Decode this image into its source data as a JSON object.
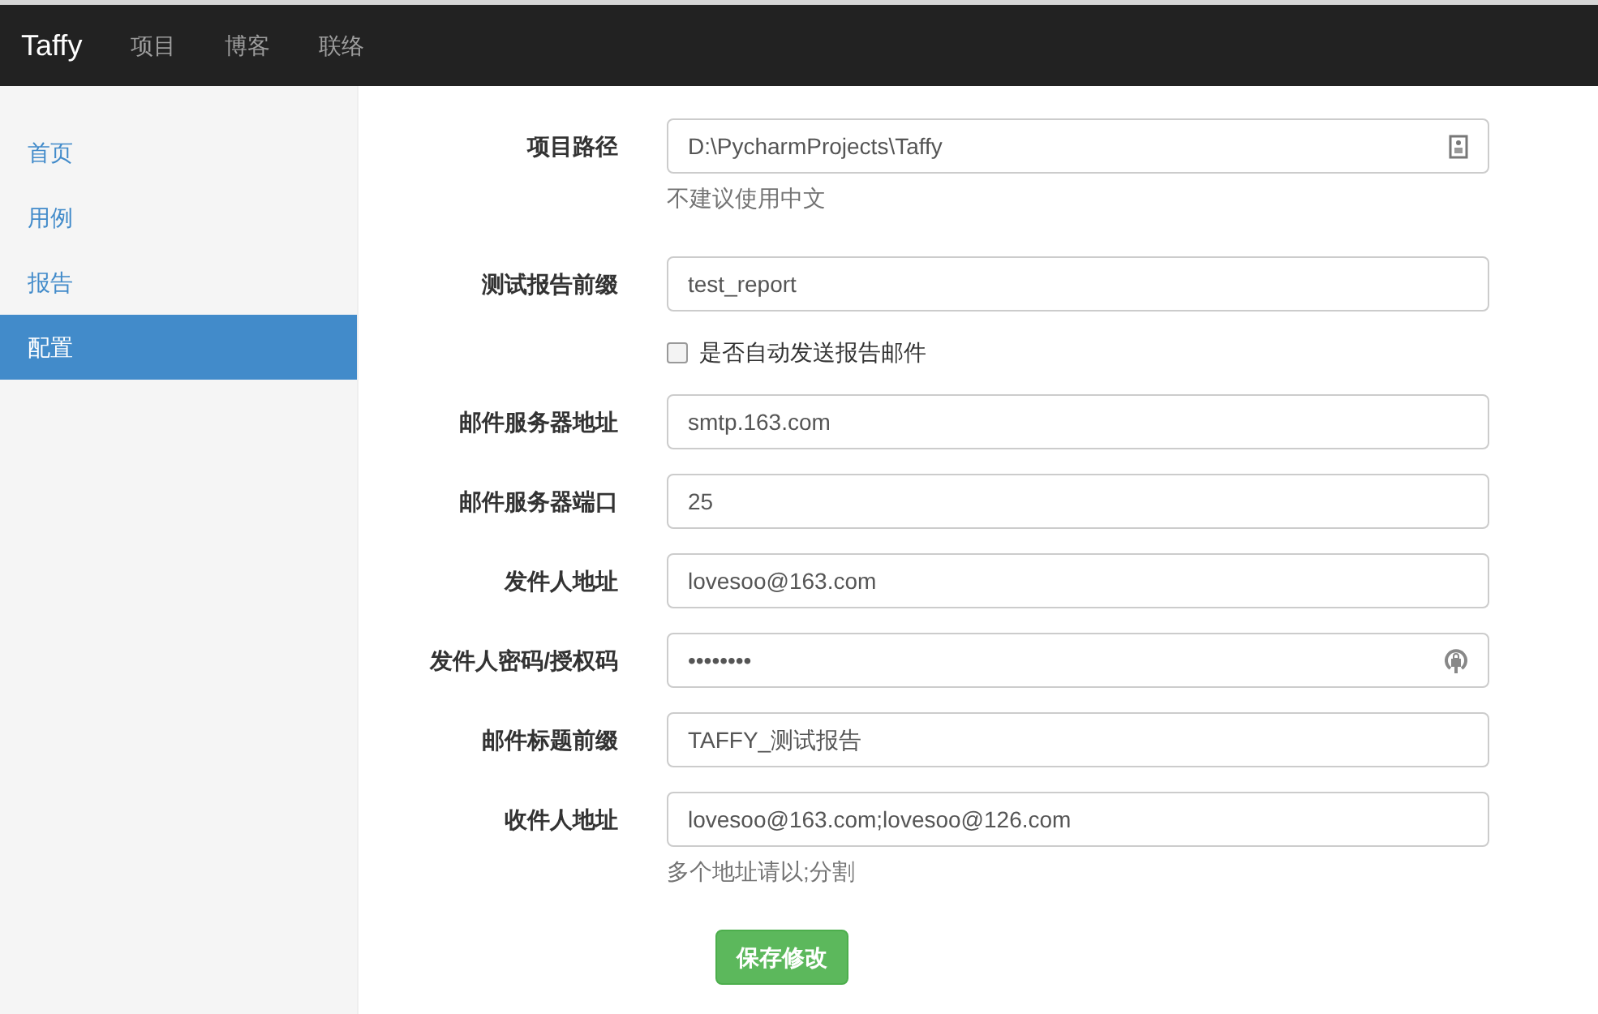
{
  "navbar": {
    "brand": "Taffy",
    "links": [
      {
        "label": "项目"
      },
      {
        "label": "博客"
      },
      {
        "label": "联络"
      }
    ]
  },
  "sidebar": {
    "items": [
      {
        "label": "首页",
        "selected": false
      },
      {
        "label": "用例",
        "selected": false
      },
      {
        "label": "报告",
        "selected": false
      },
      {
        "label": "配置",
        "selected": true
      }
    ]
  },
  "form": {
    "fields": [
      {
        "kind": "path",
        "label": "项目路径",
        "value": "D:\\PycharmProjects\\Taffy",
        "help": "不建议使用中文"
      },
      {
        "kind": "text",
        "label": "测试报告前缀",
        "value": "test_report"
      },
      {
        "kind": "checkbox",
        "label": "是否自动发送报告邮件",
        "checked": false
      },
      {
        "kind": "text",
        "label": "邮件服务器地址",
        "value": "smtp.163.com"
      },
      {
        "kind": "text",
        "label": "邮件服务器端口",
        "value": "25"
      },
      {
        "kind": "text",
        "label": "发件人地址",
        "value": "lovesoo@163.com"
      },
      {
        "kind": "password",
        "label": "发件人密码/授权码",
        "value": "••••••••"
      },
      {
        "kind": "text",
        "label": "邮件标题前缀",
        "value": "TAFFY_测试报告"
      },
      {
        "kind": "text",
        "label": "收件人地址",
        "value": "lovesoo@163.com;lovesoo@126.com",
        "help": "多个地址请以;分割"
      }
    ],
    "submit": "保存修改"
  }
}
